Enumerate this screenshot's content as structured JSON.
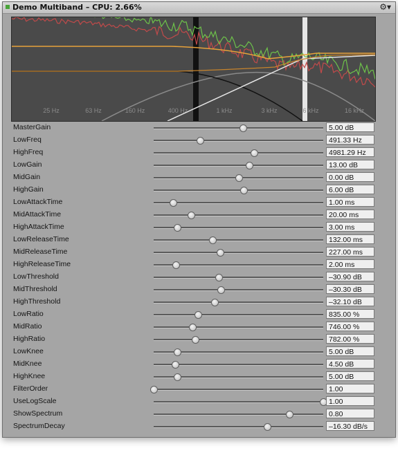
{
  "window": {
    "title": "Demo Multiband – CPU: 2.66%",
    "menu_icon": "gear-icon"
  },
  "graph": {
    "freq_labels": [
      "25 Hz",
      "63 Hz",
      "160 Hz",
      "400 Hz",
      "1 kHz",
      "3 kHz",
      "6 kHz",
      "16 kHz"
    ],
    "colors": {
      "background": "#4a4a4a",
      "spectrum_green": "#6ec24a",
      "spectrum_red": "#c24a4a",
      "gain_orange": "#e8a23a",
      "crossover_white": "#e6e6e6",
      "band_black": "#111111",
      "band_gray": "#8a8a8a"
    }
  },
  "params": [
    {
      "label": "MasterGain",
      "value": "5.00 dB",
      "pos": 0.525
    },
    {
      "label": "LowFreq",
      "value": "491.33 Hz",
      "pos": 0.275
    },
    {
      "label": "HighFreq",
      "value": "4981.29 Hz",
      "pos": 0.59
    },
    {
      "label": "LowGain",
      "value": "13.00 dB",
      "pos": 0.565
    },
    {
      "label": "MidGain",
      "value": "0.00 dB",
      "pos": 0.5
    },
    {
      "label": "HighGain",
      "value": "6.00 dB",
      "pos": 0.53
    },
    {
      "label": "LowAttackTime",
      "value": "1.00 ms",
      "pos": 0.115
    },
    {
      "label": "MidAttackTime",
      "value": "20.00 ms",
      "pos": 0.22
    },
    {
      "label": "HighAttackTime",
      "value": "3.00 ms",
      "pos": 0.14
    },
    {
      "label": "LowReleaseTime",
      "value": "132.00 ms",
      "pos": 0.345
    },
    {
      "label": "MidReleaseTime",
      "value": "227.00 ms",
      "pos": 0.39
    },
    {
      "label": "HighReleaseTime",
      "value": "2.00 ms",
      "pos": 0.13
    },
    {
      "label": "LowThreshold",
      "value": "–30.90 dB",
      "pos": 0.385
    },
    {
      "label": "MidThreshold",
      "value": "–30.30 dB",
      "pos": 0.395
    },
    {
      "label": "HighThreshold",
      "value": "–32.10 dB",
      "pos": 0.36
    },
    {
      "label": "LowRatio",
      "value": "835.00 %",
      "pos": 0.26
    },
    {
      "label": "MidRatio",
      "value": "746.00 %",
      "pos": 0.23
    },
    {
      "label": "HighRatio",
      "value": "782.00 %",
      "pos": 0.245
    },
    {
      "label": "LowKnee",
      "value": "5.00 dB",
      "pos": 0.14
    },
    {
      "label": "MidKnee",
      "value": "4.50 dB",
      "pos": 0.125
    },
    {
      "label": "HighKnee",
      "value": "5.00 dB",
      "pos": 0.14
    },
    {
      "label": "FilterOrder",
      "value": "1.00",
      "pos": 0.0
    },
    {
      "label": "UseLogScale",
      "value": "1.00",
      "pos": 1.0
    },
    {
      "label": "ShowSpectrum",
      "value": "0.80",
      "pos": 0.8
    },
    {
      "label": "SpectrumDecay",
      "value": "–16.30 dB/s",
      "pos": 0.67
    }
  ]
}
